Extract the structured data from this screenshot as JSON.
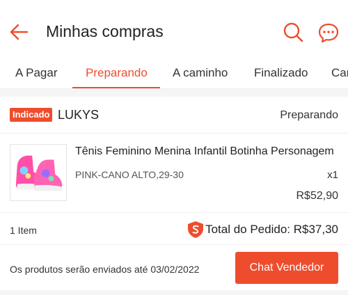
{
  "header": {
    "title": "Minhas compras",
    "back_icon": "arrow-left-icon",
    "search_icon": "search-icon",
    "chat_icon": "chat-bubble-icon",
    "accent_color": "#ee4d2d"
  },
  "tabs": [
    {
      "label": "A Pagar",
      "active": false
    },
    {
      "label": "Preparando",
      "active": true
    },
    {
      "label": "A caminho",
      "active": false
    },
    {
      "label": "Finalizado",
      "active": false
    },
    {
      "label": "Cancelado",
      "active": false
    }
  ],
  "order": {
    "badge": "Indicado",
    "shop": "LUKYS",
    "status": "Preparando",
    "product": {
      "name": "Tênis Feminino Menina Infantil Botinha Personagem",
      "variant": "PINK-CANO ALTO,29-30",
      "quantity": "x1",
      "price": "R$52,90"
    },
    "item_count": "1 Item",
    "total": "Total do Pedido: R$37,30",
    "shipping_note": "Os produtos serão enviados até 03/02/2022",
    "chat_button": "Chat Vendedor"
  }
}
